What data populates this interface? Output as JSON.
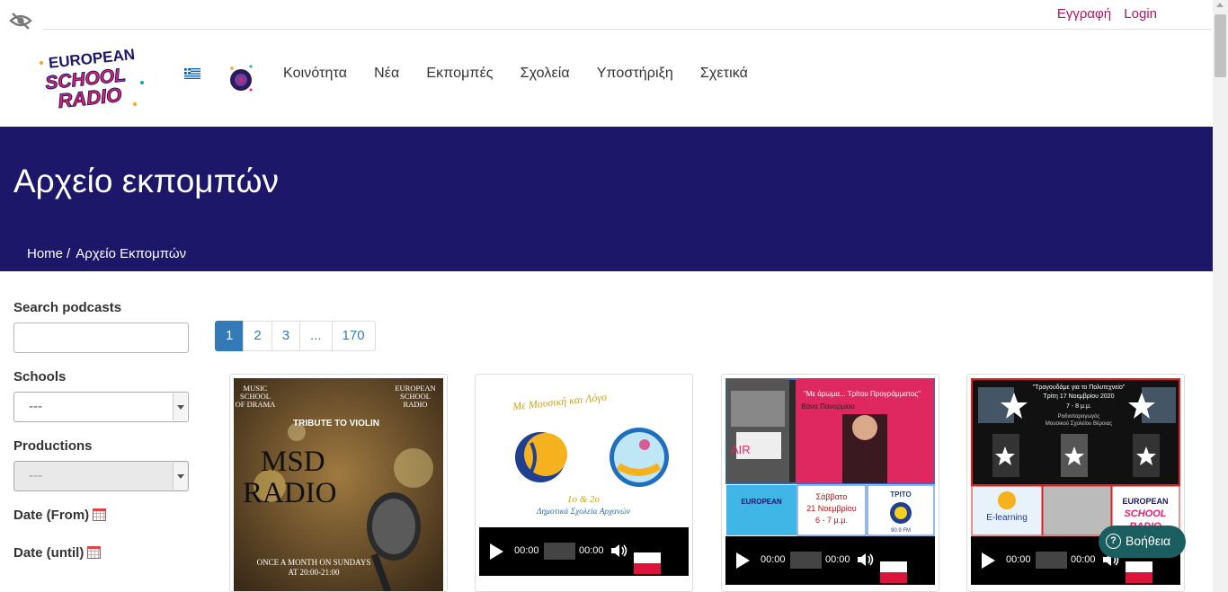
{
  "topbar": {
    "register": "Εγγραφή",
    "login": "Login"
  },
  "logo": {
    "line1": "EUROPEAN",
    "line2": "SCHOOL",
    "line3": "RADIO"
  },
  "nav": [
    "Κοινότητα",
    "Νέα",
    "Εκπομπές",
    "Σχολεία",
    "Υποστήριξη",
    "Σχετικά"
  ],
  "banner": {
    "title": "Αρχείο εκπομπών",
    "breadcrumb_home": "Home",
    "breadcrumb_sep": "/",
    "breadcrumb_current": "Αρχείο Εκπομπών"
  },
  "filters": {
    "search_label": "Search podcasts",
    "search_value": "",
    "schools_label": "Schools",
    "schools_value": "---",
    "productions_label": "Productions",
    "productions_value": "---",
    "date_from_label": "Date (From)",
    "date_until_label": "Date (until)"
  },
  "pagination": [
    "1",
    "2",
    "3",
    "...",
    "170"
  ],
  "cards": [
    {
      "thumb_top_left": [
        "MUSIC",
        "SCHOOL",
        "OF DRAMA"
      ],
      "thumb_top_right": [
        "EUROPEAN",
        "SCHOOL",
        "RADIO"
      ],
      "thumb_subtitle": "TRIBUTE TO VIOLIN",
      "thumb_title": "MSD RADIO",
      "thumb_footer": [
        "ONCE A MONTH ON SUNDAYS",
        "AT 20:00-21:00"
      ]
    },
    {
      "thumb_title": "Με Μουσική και Λόγο",
      "thumb_sub1": "1ο & 2ο",
      "thumb_sub2": "Δημοτικά Σχολεία Αρχανών",
      "time_current": "00:00",
      "time_total": "00:00"
    },
    {
      "thumb_title": "\"Με άρωμα... Τρίτου Προγράμματος\"",
      "thumb_name": "Βάνα Πανορμίου",
      "thumb_air": "AIR",
      "thumb_day": "Σάββατο",
      "thumb_date": "21 Νοεμβρίου",
      "thumb_time": "6 - 7 μ.μ.",
      "thumb_station": "ΤΡΙΤΟ",
      "thumb_freq": "90.9 FM",
      "time_current": "00:00",
      "time_total": "00:00"
    },
    {
      "thumb_title": "\"Τραγουδάμε για το Πολυτεχνείο\"",
      "thumb_date": "Τρίτη 17 Νοεμβρίου 2020",
      "thumb_time": "7 - 8 μ.μ.",
      "thumb_sub1": "Ραδιοπαραγωγός",
      "thumb_sub2": "Μουσικού Σχολείου Βέροιας",
      "thumb_elearning": "E-learning",
      "time_current": "00:00",
      "time_total": "00:00"
    }
  ],
  "help": {
    "label": "Βοήθεια",
    "icon": "?"
  },
  "colors": {
    "banner": "#1c1769",
    "accent_link": "#b0155e",
    "pagination_active": "#337ab7",
    "help_button": "#1a5e60"
  }
}
